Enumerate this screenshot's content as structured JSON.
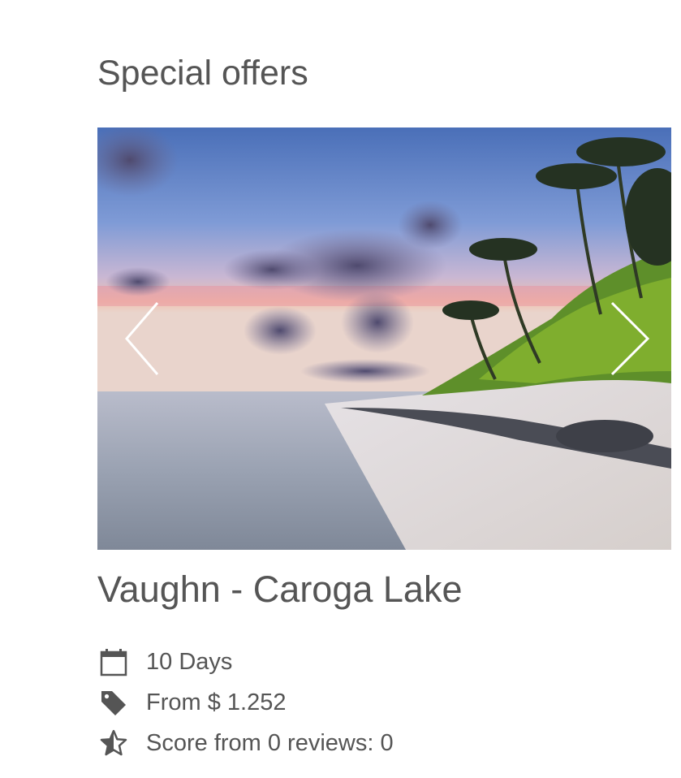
{
  "section": {
    "title": "Special offers"
  },
  "offer": {
    "image_alt": "Tropical beach with palm trees at sunset",
    "title": "Vaughn - Caroga Lake",
    "duration": "10 Days",
    "price": "From $ 1.252",
    "score": "Score from 0 reviews: 0"
  },
  "icons": {
    "duration": "calendar-icon",
    "price": "price-tag-icon",
    "score": "star-half-icon",
    "prev": "chevron-left-icon",
    "next": "chevron-right-icon"
  },
  "colors": {
    "text": "#555555",
    "background": "#ffffff",
    "arrow": "#ffffff"
  }
}
